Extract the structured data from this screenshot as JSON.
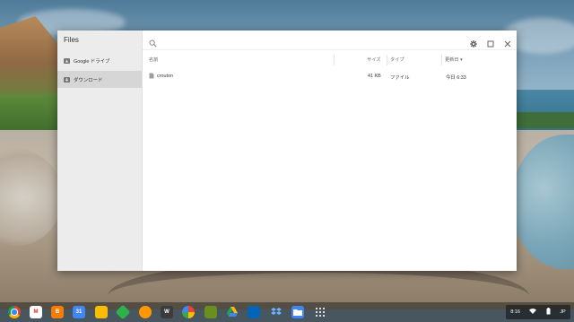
{
  "window": {
    "app_title": "Files",
    "sidebar": {
      "items": [
        {
          "label": "Google ドライブ",
          "icon": "google-drive-icon",
          "selected": false
        },
        {
          "label": "ダウンロード",
          "icon": "downloads-folder-icon",
          "selected": true
        }
      ]
    },
    "toolbar": {
      "search_icon": "search-icon",
      "settings_icon": "gear-icon",
      "maximize_icon": "maximize-icon",
      "close_icon": "close-icon"
    },
    "columns": {
      "name": "名前",
      "size": "サイズ",
      "type": "タイプ",
      "date": "更新日 ▾"
    },
    "files": [
      {
        "name": "crouton",
        "size": "41 KB",
        "type": "ファイル",
        "date": "今日 6:33",
        "icon": "file-icon"
      }
    ]
  },
  "shelf": {
    "apps": [
      {
        "name": "chrome-icon",
        "label": "",
        "color": "#db4437"
      },
      {
        "name": "gmail-icon",
        "label": "M",
        "color": "#d93025"
      },
      {
        "name": "blogger-icon",
        "label": "B",
        "color": "#f57d00"
      },
      {
        "name": "calendar-icon",
        "label": "31",
        "color": "#4285f4"
      },
      {
        "name": "keep-icon",
        "label": "",
        "color": "#fbbc04"
      },
      {
        "name": "feedly-icon",
        "label": "",
        "color": "#2bb24c"
      },
      {
        "name": "headphones-icon",
        "label": "",
        "color": "#ff9800"
      },
      {
        "name": "app-w-icon",
        "label": "W",
        "color": "#3c3c3c"
      },
      {
        "name": "photos-icon",
        "label": "",
        "color": "#ffffff"
      },
      {
        "name": "evernote-icon",
        "label": "",
        "color": "#6b8e23"
      },
      {
        "name": "drive-icon",
        "label": "",
        "color": "#1fa463"
      },
      {
        "name": "onedrive-icon",
        "label": "",
        "color": "#0364b8"
      },
      {
        "name": "dropbox-icon",
        "label": "",
        "color": "#0061ff"
      },
      {
        "name": "files-icon",
        "label": "",
        "color": "#4285f4"
      },
      {
        "name": "app-launcher-icon",
        "label": "",
        "color": "#666666"
      }
    ],
    "tray": {
      "time": "8:16",
      "ime": "JP"
    }
  }
}
